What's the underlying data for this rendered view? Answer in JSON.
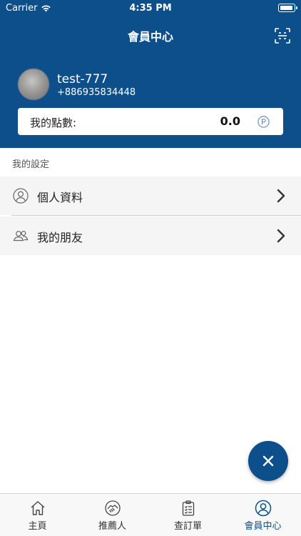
{
  "status_bar": {
    "carrier": "Carrier",
    "time": "4:35 PM"
  },
  "header": {
    "title": "會員中心"
  },
  "profile": {
    "username": "test-777",
    "phone": "+886935834448"
  },
  "points": {
    "label": "我的點數:",
    "value": "0.0"
  },
  "settings": {
    "section_label": "我的設定",
    "items": [
      {
        "label": "個人資料",
        "icon": "person-icon"
      },
      {
        "label": "我的朋友",
        "icon": "friends-icon"
      }
    ]
  },
  "tabs": [
    {
      "label": "主頁",
      "icon": "home-icon"
    },
    {
      "label": "推薦人",
      "icon": "handshake-icon"
    },
    {
      "label": "查訂單",
      "icon": "clipboard-icon"
    },
    {
      "label": "會員中心",
      "icon": "user-circle-icon",
      "active": true
    }
  ],
  "colors": {
    "brand": "#0d4f8b",
    "row_bg": "#f5f5f5",
    "tabbar_bg": "#f8f8f8"
  }
}
